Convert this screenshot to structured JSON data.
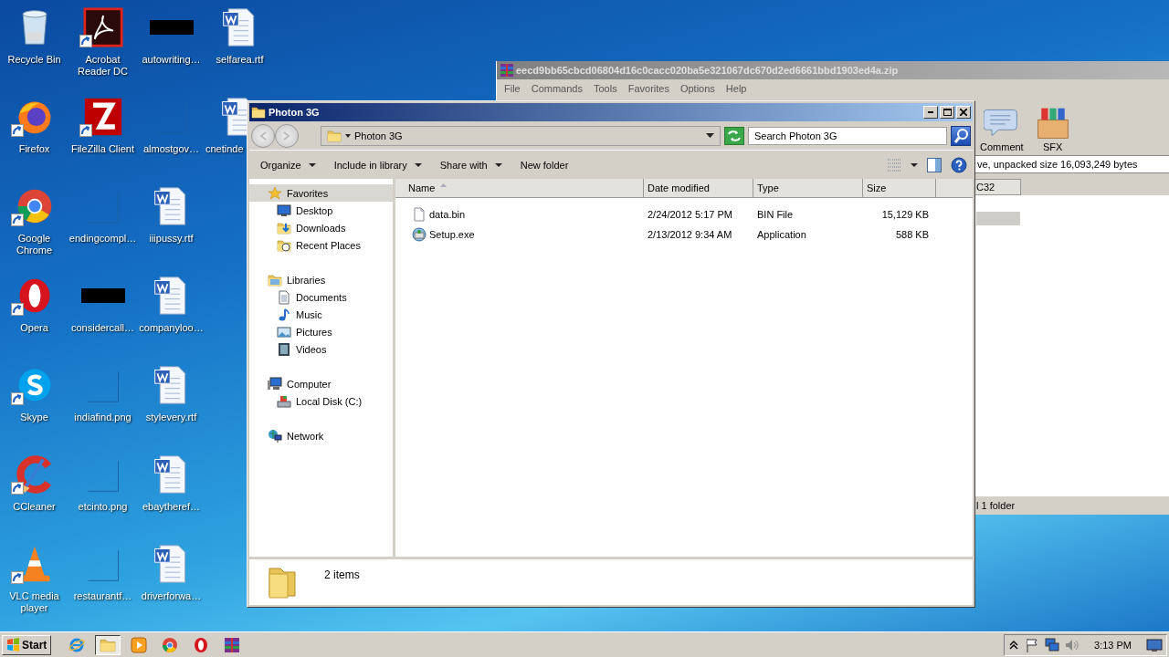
{
  "desktop": {
    "icons": [
      {
        "label": "Recycle Bin",
        "kind": "recycle",
        "shortcut": false
      },
      {
        "label": "Firefox",
        "kind": "firefox",
        "shortcut": true
      },
      {
        "label": "Google Chrome",
        "kind": "chrome",
        "shortcut": true
      },
      {
        "label": "Opera",
        "kind": "opera",
        "shortcut": true
      },
      {
        "label": "Skype",
        "kind": "skype",
        "shortcut": true
      },
      {
        "label": "CCleaner",
        "kind": "ccleaner",
        "shortcut": true
      },
      {
        "label": "VLC media player",
        "kind": "vlc",
        "shortcut": true
      },
      {
        "label": "Acrobat Reader DC",
        "kind": "acrobat",
        "shortcut": true
      },
      {
        "label": "FileZilla Client",
        "kind": "filezilla",
        "shortcut": true
      },
      {
        "label": "endingcompl…",
        "kind": "blank",
        "shortcut": false
      },
      {
        "label": "considercall…",
        "kind": "black",
        "shortcut": false
      },
      {
        "label": "indiafind.png",
        "kind": "blank",
        "shortcut": false
      },
      {
        "label": "etcinto.png",
        "kind": "blank",
        "shortcut": false
      },
      {
        "label": "restaurantf…",
        "kind": "blank",
        "shortcut": false
      },
      {
        "label": "autowriting…",
        "kind": "black",
        "shortcut": false
      },
      {
        "label": "almostgov…",
        "kind": "blank",
        "shortcut": false
      },
      {
        "label": "iiipussy.rtf",
        "kind": "word",
        "shortcut": false
      },
      {
        "label": "companyloo…",
        "kind": "word",
        "shortcut": false
      },
      {
        "label": "stylevery.rtf",
        "kind": "word",
        "shortcut": false
      },
      {
        "label": "ebaytheref…",
        "kind": "word",
        "shortcut": false
      },
      {
        "label": "driverforwa…",
        "kind": "word",
        "shortcut": false
      },
      {
        "label": "selfarea.rtf",
        "kind": "word",
        "shortcut": false
      },
      {
        "label": "cnetinde",
        "kind": "word",
        "shortcut": false
      }
    ]
  },
  "archive_window": {
    "title": "eecd9bb65cbcd06804d16c0cacc020ba5e321067dc670d2ed6661bbd1903ed4a.zip",
    "menu": [
      "File",
      "Commands",
      "Tools",
      "Favorites",
      "Options",
      "Help"
    ],
    "toolbar": [
      {
        "label": "Comment",
        "kind": "comment"
      },
      {
        "label": "SFX",
        "kind": "sfx"
      }
    ],
    "address": "ve, unpacked size 16,093,249 bytes",
    "columns": [
      "C32"
    ],
    "status": "l 1 folder"
  },
  "explorer": {
    "title": "Photon 3G",
    "breadcrumb": "Photon 3G",
    "search": {
      "placeholder": "Search Photon 3G"
    },
    "toolbar": [
      {
        "label": "Organize",
        "dropdown": true
      },
      {
        "label": "Include in library",
        "dropdown": true
      },
      {
        "label": "Share with",
        "dropdown": true
      },
      {
        "label": "New folder",
        "dropdown": false
      }
    ],
    "nav": [
      {
        "label": "Favorites",
        "kind": "star",
        "selected": true,
        "children": [
          {
            "label": "Desktop",
            "kind": "desktop",
            "selected": false
          },
          {
            "label": "Downloads",
            "kind": "downloads",
            "selected": false
          },
          {
            "label": "Recent Places",
            "kind": "recent",
            "selected": false
          }
        ]
      },
      {
        "label": "Libraries",
        "kind": "libraries",
        "selected": false,
        "children": [
          {
            "label": "Documents",
            "kind": "documents",
            "selected": false
          },
          {
            "label": "Music",
            "kind": "music",
            "selected": false
          },
          {
            "label": "Pictures",
            "kind": "pictures",
            "selected": false
          },
          {
            "label": "Videos",
            "kind": "videos",
            "selected": false
          }
        ]
      },
      {
        "label": "Computer",
        "kind": "computer",
        "selected": false,
        "children": [
          {
            "label": "Local Disk (C:)",
            "kind": "disk",
            "selected": false
          }
        ]
      },
      {
        "label": "Network",
        "kind": "network",
        "selected": false
      }
    ],
    "columns": [
      {
        "label": "Name",
        "sorted": true
      },
      {
        "label": "Date modified",
        "sorted": false
      },
      {
        "label": "Type",
        "sorted": false
      },
      {
        "label": "Size",
        "sorted": false
      }
    ],
    "rows": [
      {
        "name": "data.bin",
        "kind": "bin",
        "date": "2/24/2012 5:17 PM",
        "type": "BIN File",
        "size": "15,129 KB"
      },
      {
        "name": "Setup.exe",
        "kind": "exe",
        "date": "2/13/2012 9:34 AM",
        "type": "Application",
        "size": "588 KB"
      }
    ],
    "status": "2 items"
  },
  "taskbar": {
    "start": "Start",
    "apps": [
      {
        "kind": "ie",
        "selected": false
      },
      {
        "kind": "explorer",
        "selected": true
      },
      {
        "kind": "media",
        "selected": false
      },
      {
        "kind": "chrome",
        "selected": false
      },
      {
        "kind": "opera",
        "selected": false
      },
      {
        "kind": "winrar",
        "selected": false
      }
    ],
    "clock": "3:13 PM"
  }
}
